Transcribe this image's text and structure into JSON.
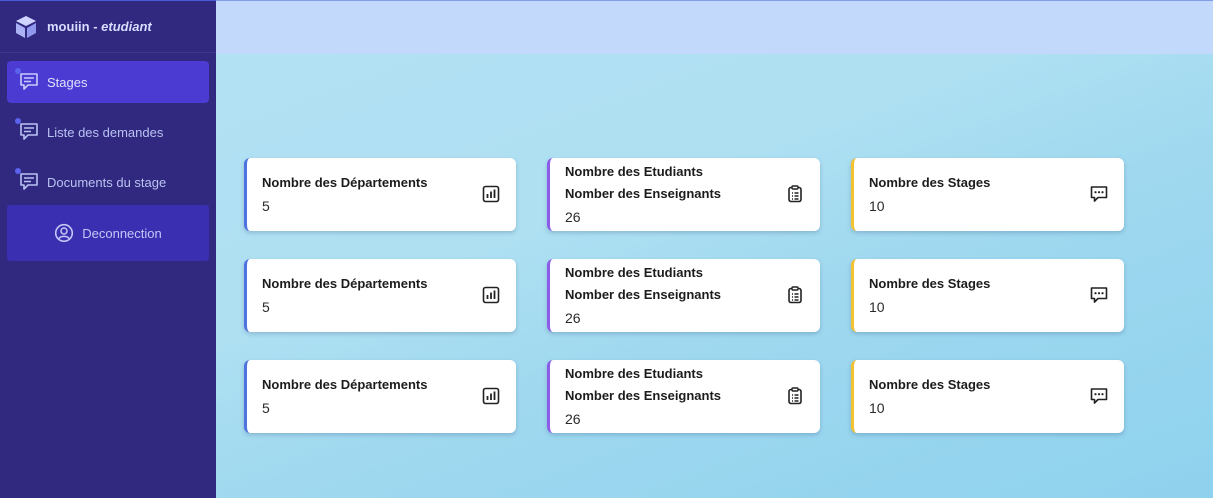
{
  "brand": {
    "name": "mouiin",
    "separator": " - ",
    "role": "etudiant"
  },
  "sidebar": {
    "items": [
      {
        "label": "Stages",
        "active": true
      },
      {
        "label": "Liste des demandes",
        "active": false
      },
      {
        "label": "Documents du stage",
        "active": false
      }
    ],
    "logout_label": "Deconnection"
  },
  "cards": [
    {
      "title": "Nombre des Départements",
      "value": "5",
      "icon": "bar-chart-icon",
      "accent": "#4e73df"
    },
    {
      "title_line1": "Nombre des Etudiants",
      "title_line2": "Nomber des Enseignants",
      "value": "26",
      "icon": "clipboard-icon",
      "accent": "#8a5ce8"
    },
    {
      "title": "Nombre des Stages",
      "value": "10",
      "icon": "comment-dots-icon",
      "accent": "#f2c230"
    }
  ],
  "colors": {
    "sidebar_bg": "#31297f",
    "active_item": "#4b3bd2",
    "topbar": "#c2d9fb",
    "main_bg": "#aee0f2"
  }
}
